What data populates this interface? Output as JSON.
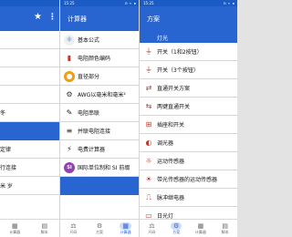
{
  "left": {
    "status_time": "",
    "items": [
      {
        "label": "",
        "selected": false
      },
      {
        "label": "",
        "selected": false
      },
      {
        "label": "",
        "selected": false
      },
      {
        "label": "",
        "selected": false
      },
      {
        "label": "冬",
        "selected": false
      },
      {
        "label": "",
        "selected": true
      },
      {
        "label": "定律",
        "selected": false
      },
      {
        "label": "行连接",
        "selected": false
      },
      {
        "label": "米 岁",
        "selected": false
      }
    ],
    "nav": [
      {
        "icon": "▦",
        "label": "计算器"
      },
      {
        "icon": "▤",
        "label": "脚本"
      }
    ]
  },
  "middle": {
    "status_time": "15:25",
    "status_right": "⊟ ▾ ▪",
    "title": "计算器",
    "items": [
      {
        "label": "基本公式",
        "icon": "⚛",
        "icon_name": "atom-icon",
        "icon_bg": "#f0f0f0",
        "icon_color": "#2a7bd0"
      },
      {
        "label": "电阻颜色编码",
        "icon": "▮",
        "icon_name": "resistor-color-icon",
        "icon_bg": "#ffffff",
        "icon_color": "#c0392b"
      },
      {
        "label": "直径部分",
        "icon": "●",
        "icon_name": "diameter-icon",
        "icon_bg": "#f39c12",
        "icon_color": "#ffffff"
      },
      {
        "label": "AWG以毫米和毫米²",
        "icon": "⚙",
        "icon_name": "wire-gauge-icon",
        "icon_bg": "#ffffff",
        "icon_color": "#333333"
      },
      {
        "label": "电阻串联",
        "icon": "✎",
        "icon_name": "resistor-series-icon",
        "icon_bg": "#ffffff",
        "icon_color": "#222222"
      },
      {
        "label": "并联电阻连接",
        "icon": "≡",
        "icon_name": "resistor-parallel-icon",
        "icon_bg": "#ffffff",
        "icon_color": "#222222"
      },
      {
        "label": "电费计算器",
        "icon": "⚡",
        "icon_name": "energy-cost-icon",
        "icon_bg": "#ffffff",
        "icon_color": "#222222"
      },
      {
        "label": "国际单位制和 SI 前缀",
        "icon": "SI",
        "icon_name": "si-units-icon",
        "icon_bg": "#8e44ad",
        "icon_color": "#ffffff"
      }
    ],
    "nav": [
      {
        "icon": "⚖",
        "label": "尺码"
      },
      {
        "icon": "⚙",
        "label": "方案"
      },
      {
        "icon": "▦",
        "label": "计算器"
      }
    ],
    "nav_active": 2
  },
  "right": {
    "status_time": "15:25",
    "status_right": "⊟ ▾ ▪",
    "title": "方案",
    "section": "灯光",
    "items": [
      {
        "label": "开关（1和2按钮）",
        "icon": "⏚",
        "icon_name": "switch-two-button-icon"
      },
      {
        "label": "开关（3个按钮）",
        "icon": "⏚",
        "icon_name": "switch-three-button-icon"
      },
      {
        "label": "直通开关方案",
        "icon": "⇄",
        "icon_name": "pass-through-switch-icon"
      },
      {
        "label": "两键直通开关",
        "icon": "⇆",
        "icon_name": "two-key-pass-switch-icon"
      },
      {
        "label": "插座和开关",
        "icon": "⊞",
        "icon_name": "socket-switch-icon"
      },
      {
        "label": "调光器",
        "icon": "◐",
        "icon_name": "dimmer-icon"
      },
      {
        "label": "运动传感器",
        "icon": "☼",
        "icon_name": "motion-sensor-icon"
      },
      {
        "label": "带光传感器的运动传感器",
        "icon": "☀",
        "icon_name": "light-motion-sensor-icon"
      },
      {
        "label": "脉冲继电器",
        "icon": "⎍",
        "icon_name": "impulse-relay-icon"
      },
      {
        "label": "日光灯",
        "icon": "▭",
        "icon_name": "fluorescent-lamp-icon"
      }
    ],
    "nav": [
      {
        "icon": "⚖",
        "label": "尺码"
      },
      {
        "icon": "⚙",
        "label": "方案"
      },
      {
        "icon": "▦",
        "label": "计算器"
      },
      {
        "icon": "▤",
        "label": "脚本"
      }
    ],
    "nav_active": 1
  },
  "icons": {
    "star": "★",
    "menu": "⋮"
  },
  "colors": {
    "primary": "#2965d1",
    "statusbar": "#1a5bc4",
    "active_pill": "#cfdcf7"
  }
}
